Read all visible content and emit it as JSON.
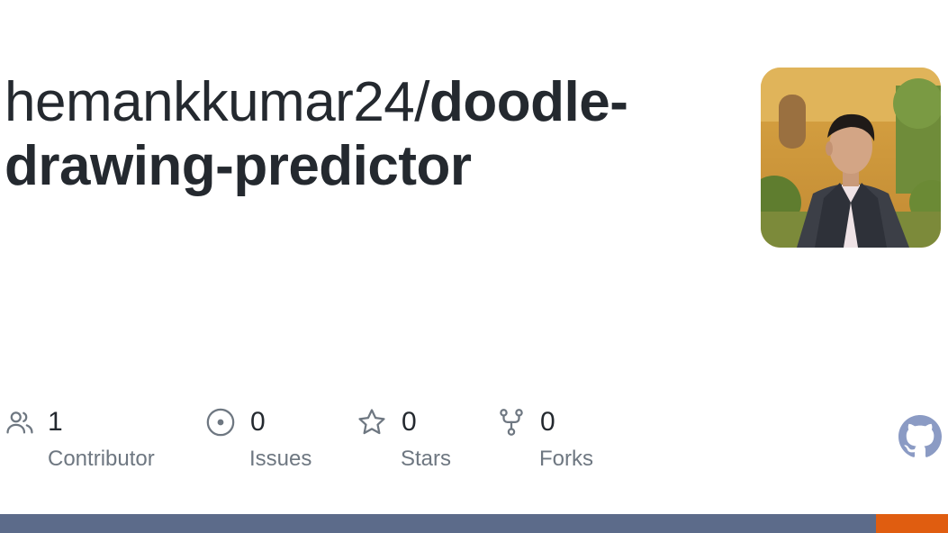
{
  "repo": {
    "owner": "hemankkumar24/",
    "name": "doodle-drawing-predictor"
  },
  "stats": [
    {
      "icon": "contributors-icon",
      "count": "1",
      "label": "Contributor"
    },
    {
      "icon": "issues-icon",
      "count": "0",
      "label": "Issues"
    },
    {
      "icon": "star-icon",
      "count": "0",
      "label": "Stars"
    },
    {
      "icon": "fork-icon",
      "count": "0",
      "label": "Forks"
    }
  ],
  "colors": {
    "title": "#24292f",
    "label": "#6e7781",
    "icon": "#6e7781",
    "github_mark": "#8b9bc4"
  },
  "languages": [
    {
      "color": "#5c6b8a",
      "fraction": 0.924
    },
    {
      "color": "#e05d10",
      "fraction": 0.076
    }
  ]
}
